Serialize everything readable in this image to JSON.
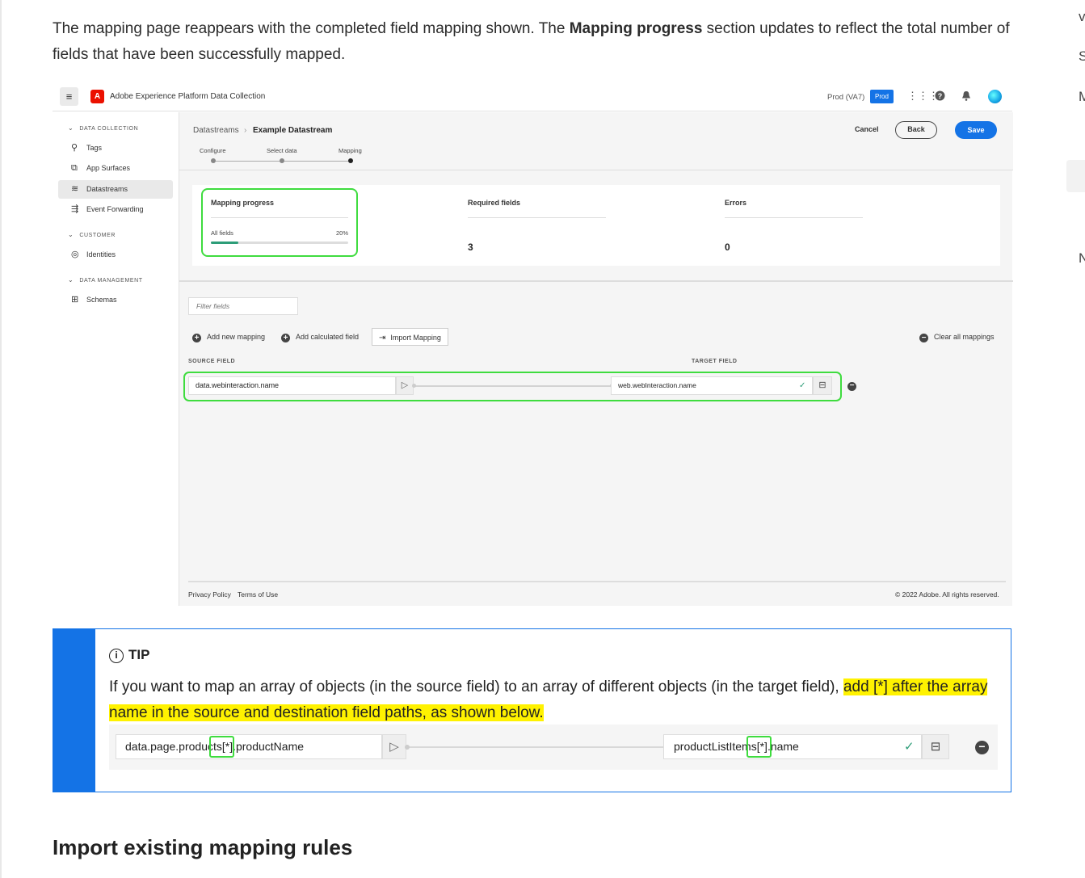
{
  "intro": {
    "before": "The mapping page reappears with the completed field mapping shown. The ",
    "bold": "Mapping progress",
    "after": " section updates to reflect the total number of fields that have been successfully mapped."
  },
  "right_rail": {
    "letters": [
      "v",
      "S",
      "M",
      "N"
    ]
  },
  "app": {
    "menu_icon": "≡",
    "logo_icon": "adobe-logo-icon",
    "title": "Adobe Experience Platform Data Collection",
    "env_label": "Prod (VA7)",
    "env_badge": "Prod"
  },
  "sidenav": {
    "sections": [
      {
        "label": "DATA COLLECTION"
      },
      {
        "label": "CUSTOMER"
      },
      {
        "label": "DATA MANAGEMENT"
      }
    ],
    "items": [
      {
        "label": "Tags",
        "icon": "tags-icon"
      },
      {
        "label": "App Surfaces",
        "icon": "app-surfaces-icon"
      },
      {
        "label": "Datastreams",
        "icon": "datastreams-icon",
        "selected": true
      },
      {
        "label": "Event Forwarding",
        "icon": "event-forwarding-icon"
      },
      {
        "label": "Identities",
        "icon": "fingerprint-icon"
      },
      {
        "label": "Schemas",
        "icon": "schema-icon"
      }
    ]
  },
  "header": {
    "breadcrumb": [
      "Datastreams",
      "Example Datastream"
    ],
    "cancel": "Cancel",
    "back": "Back",
    "save": "Save",
    "steps": [
      "Configure",
      "Select data",
      "Mapping"
    ]
  },
  "progress": {
    "mapping_title": "Mapping progress",
    "all_fields_label": "All fields",
    "percent_label": "20%",
    "percent_value": 0.2,
    "required_title": "Required fields",
    "required_value": "3",
    "errors_title": "Errors",
    "errors_value": "0"
  },
  "mapping": {
    "filter_placeholder": "Filter fields",
    "add_new": "Add new mapping",
    "add_calculated": "Add calculated field",
    "import": "Import Mapping",
    "clear_all": "Clear all mappings",
    "source_header": "SOURCE FIELD",
    "target_header": "TARGET FIELD",
    "source_value": "data.webinteraction.name",
    "target_value": "web.webInteraction.name"
  },
  "footer": {
    "privacy": "Privacy Policy",
    "terms": "Terms of Use",
    "copyright": "© 2022 Adobe. All rights reserved."
  },
  "tip": {
    "heading": "TIP",
    "text_plain": "If you want to map an array of objects (in the source field) to an array of different objects (in the target field), ",
    "text_highlight_1": "add ",
    "text_code": "[*]",
    "text_highlight_2": " after the array name in the source and destination field paths, as shown below.",
    "source_example": "data.page.products[*].productName",
    "target_example": "productListItems[*].name"
  },
  "next_section_heading": "Import existing mapping rules",
  "colors": {
    "accent_blue": "#1473e6",
    "highlight_green": "#3fdc3f",
    "highlight_yellow": "#fff200",
    "success_green": "#2d9d78"
  }
}
